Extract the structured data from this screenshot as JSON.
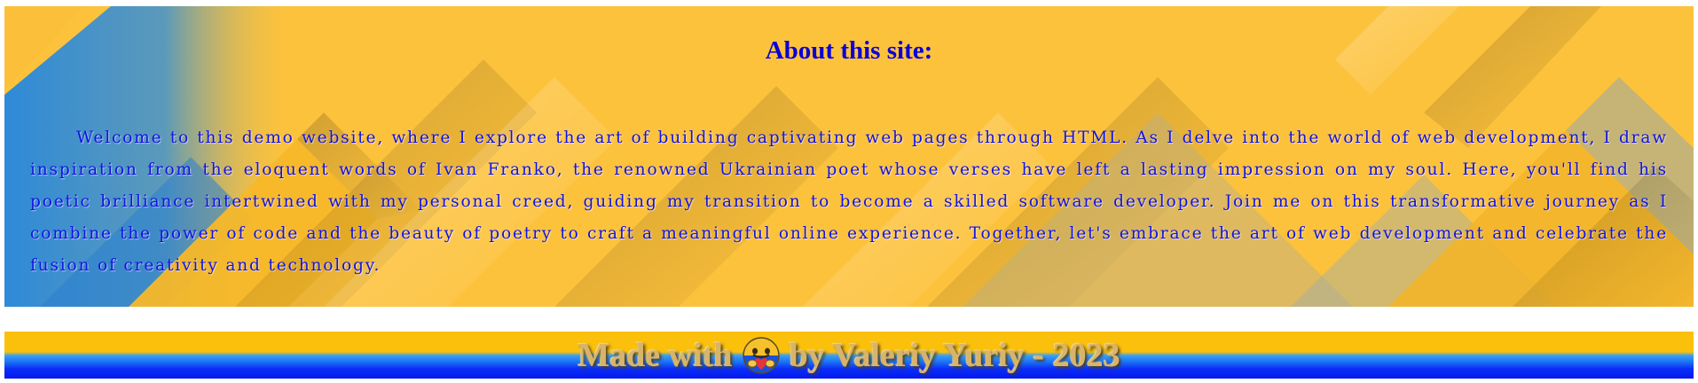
{
  "about": {
    "title": "About this site:",
    "text": "Welcome to this demo website, where I explore the art of building captivating web pages through HTML. As I delve into the world of web development, I draw inspiration from the eloquent words of Ivan Franko, the renowned Ukrainian poet whose verses have left a lasting impression on my soul. Here, you'll find his poetic brilliance intertwined with my personal creed, guiding my transition to become a skilled software developer. Join me on this transformative journey as I combine the power of code and the beauty of poetry to craft a meaningful online experience. Together, let's embrace the art of web development and celebrate the fusion of creativity and technology."
  },
  "footer": {
    "prefix": "Made with",
    "icon": "ukraine-heart-emoji-icon",
    "suffix": "by Valeriy Yuriy - 2023"
  },
  "colors": {
    "background_yellow": "#fdc23c",
    "background_blue": "#2e8ad8",
    "title": "#0a00d8",
    "body_text": "#1212e6",
    "footer_yellow": "#fbc00c",
    "footer_blue": "#0418ee",
    "footer_text": "#d8b46a"
  }
}
